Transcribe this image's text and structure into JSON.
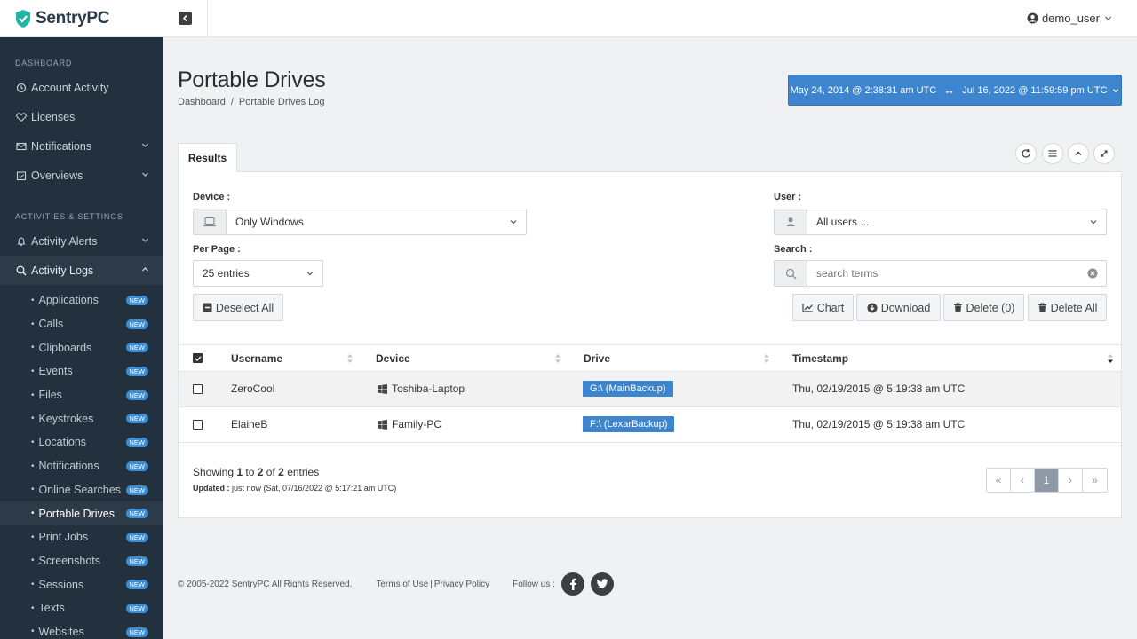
{
  "brand": {
    "name": "SentryPC"
  },
  "user": {
    "name": "demo_user"
  },
  "sidebar": {
    "section_dashboard": "DASHBOARD",
    "dashboard_items": [
      {
        "label": "Account Activity",
        "icon": "history-icon"
      },
      {
        "label": "Licenses",
        "icon": "heart-icon"
      },
      {
        "label": "Notifications",
        "icon": "envelope-icon"
      },
      {
        "label": "Overviews",
        "icon": "calendar-check-icon"
      }
    ],
    "section_activities": "ACTIVITIES & SETTINGS",
    "activity_items": [
      {
        "label": "Activity Alerts",
        "icon": "bell-icon"
      },
      {
        "label": "Activity Logs",
        "icon": "search-icon"
      }
    ],
    "sub_items": [
      {
        "label": "Applications",
        "badge": "NEW"
      },
      {
        "label": "Calls",
        "badge": "NEW"
      },
      {
        "label": "Clipboards",
        "badge": "NEW"
      },
      {
        "label": "Events",
        "badge": "NEW"
      },
      {
        "label": "Files",
        "badge": "NEW"
      },
      {
        "label": "Keystrokes",
        "badge": "NEW"
      },
      {
        "label": "Locations",
        "badge": "NEW"
      },
      {
        "label": "Notifications",
        "badge": "NEW"
      },
      {
        "label": "Online Searches",
        "badge": "NEW"
      },
      {
        "label": "Portable Drives",
        "badge": "NEW"
      },
      {
        "label": "Print Jobs",
        "badge": "NEW"
      },
      {
        "label": "Screenshots",
        "badge": "NEW"
      },
      {
        "label": "Sessions",
        "badge": "NEW"
      },
      {
        "label": "Texts",
        "badge": "NEW"
      },
      {
        "label": "Websites",
        "badge": "NEW"
      }
    ]
  },
  "page": {
    "title": "Portable Drives",
    "breadcrumb": [
      "Dashboard",
      "/",
      "Portable Drives Log"
    ],
    "date_range": {
      "start": "May 24, 2014 @ 2:38:31 am UTC",
      "arrow": "↔",
      "end": "Jul 16, 2022 @ 11:59:59 pm UTC"
    }
  },
  "tabs": {
    "results": "Results"
  },
  "filters": {
    "device_label": "Device :",
    "device_value": "Only Windows",
    "per_page_label": "Per Page :",
    "per_page_value": "25 entries",
    "user_label": "User :",
    "user_value": "All users ...",
    "search_label": "Search :",
    "search_placeholder": "search terms"
  },
  "actions": {
    "deselect_all": "Deselect All",
    "chart": "Chart",
    "download": "Download",
    "delete": "Delete (0)",
    "delete_all": "Delete All"
  },
  "table": {
    "columns": [
      "Username",
      "Device",
      "Drive",
      "Timestamp"
    ],
    "rows": [
      {
        "username": "ZeroCool",
        "device": "Toshiba-Laptop",
        "drive": "G:\\ (MainBackup)",
        "timestamp": "Thu, 02/19/2015 @ 5:19:38 am UTC"
      },
      {
        "username": "ElaineB",
        "device": "Family-PC",
        "drive": "F:\\ (LexarBackup)",
        "timestamp": "Thu, 02/19/2015 @ 5:19:38 am UTC"
      }
    ]
  },
  "info": {
    "showing_prefix": "Showing",
    "from": "1",
    "to_word": "to",
    "to": "2",
    "of_word": "of",
    "total": "2",
    "suffix": "entries",
    "updated_label": "Updated :",
    "updated_value": "just now (Sat, 07/16/2022 @ 5:17:21 am UTC)"
  },
  "pagination": {
    "first": "«",
    "prev": "‹",
    "current": "1",
    "next": "›",
    "last": "»"
  },
  "footer": {
    "copyright": "© 2005-2022 SentryPC All Rights Reserved.",
    "terms": "Terms of Use",
    "separator": "|",
    "privacy": "Privacy Policy",
    "follow": "Follow us :"
  },
  "colors": {
    "primary": "#3d86cf",
    "sidebar_bg": "#23303d",
    "page_bg": "#eff1f3"
  }
}
